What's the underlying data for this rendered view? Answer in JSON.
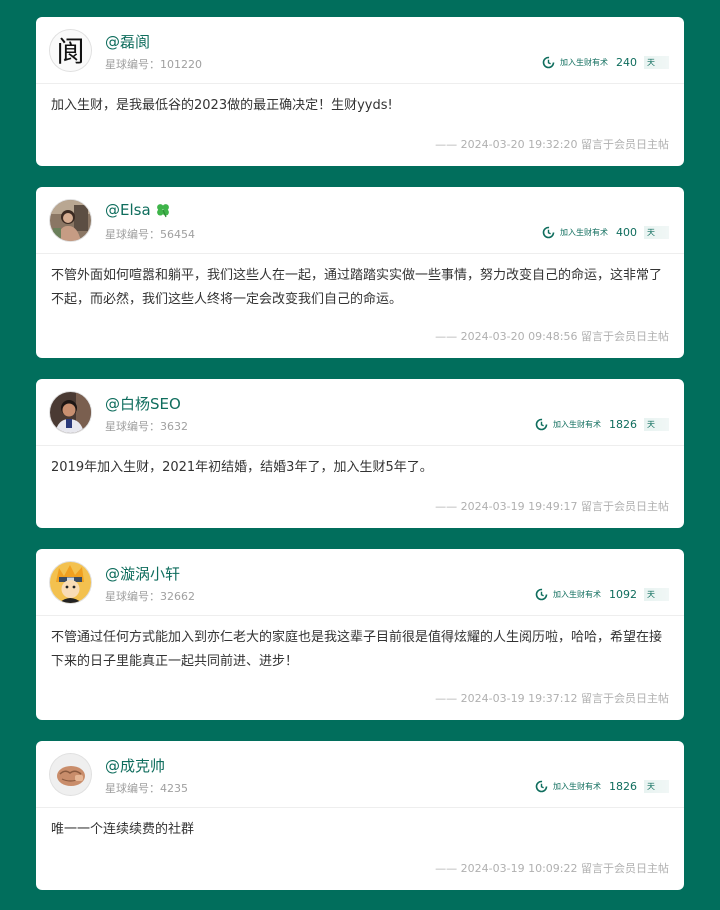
{
  "joined_label": "加入生财有术",
  "joined_unit": "天",
  "member_id_prefix": "星球编号：",
  "posts": [
    {
      "username": "@磊阆",
      "avatar": "calligraphy-character-avatar",
      "avatar_char": "阆",
      "member_id": "101220",
      "joined_days": "240",
      "content": "加入生财，是我最低谷的2023做的最正确决定！生财yyds!",
      "footer": "—— 2024-03-20 19:32:20 留言于会员日主帖"
    },
    {
      "username": "@Elsa",
      "avatar": "woman-photo-avatar",
      "badge": "clover-icon",
      "member_id": "56454",
      "joined_days": "400",
      "content": "不管外面如何喧嚣和躺平，我们这些人在一起，通过踏踏实实做一些事情，努力改变自己的命运，这非常了不起，而必然，我们这些人终将一定会改变我们自己的命运。",
      "footer": "—— 2024-03-20 09:48:56 留言于会员日主帖"
    },
    {
      "username": "@白杨SEO",
      "avatar": "man-photo-avatar",
      "member_id": "3632",
      "joined_days": "1826",
      "content": "2019年加入生财，2021年初结婚，结婚3年了，加入生财5年了。",
      "footer": "—— 2024-03-19 19:49:17 留言于会员日主帖"
    },
    {
      "username": "@漩涡小轩",
      "avatar": "cartoon-ninja-avatar",
      "member_id": "32662",
      "joined_days": "1092",
      "content": "不管通过任何方式能加入到亦仁老大的家庭也是我这辈子目前很是值得炫耀的人生阅历啦，哈哈，希望在接下来的日子里能真正一起共同前进、进步！",
      "footer": "—— 2024-03-19 19:37:12 留言于会员日主帖"
    },
    {
      "username": "@成克帅",
      "avatar": "fist-photo-avatar",
      "member_id": "4235",
      "joined_days": "1826",
      "content": "唯一一个连续续费的社群",
      "footer": "—— 2024-03-19 10:09:22 留言于会员日主帖"
    }
  ]
}
